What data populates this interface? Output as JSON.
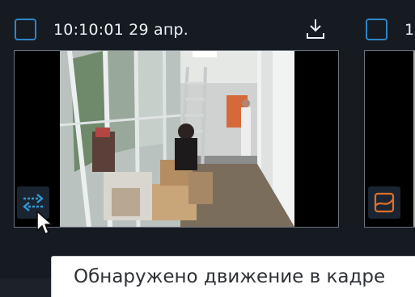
{
  "cameras": [
    {
      "timestamp": "10:10:01 29 апр.",
      "event_icon": "motion-arrows-icon",
      "download_icon": "download-icon"
    },
    {
      "timestamp": "1",
      "event_icon": "line-crossing-icon"
    }
  ],
  "tooltip": {
    "text": "Обнаружено движение в кадре"
  },
  "colors": {
    "accent": "#2f86c8",
    "motion": "#2f9bd8",
    "line_cross": "#e0702a",
    "background": "#161a21"
  }
}
